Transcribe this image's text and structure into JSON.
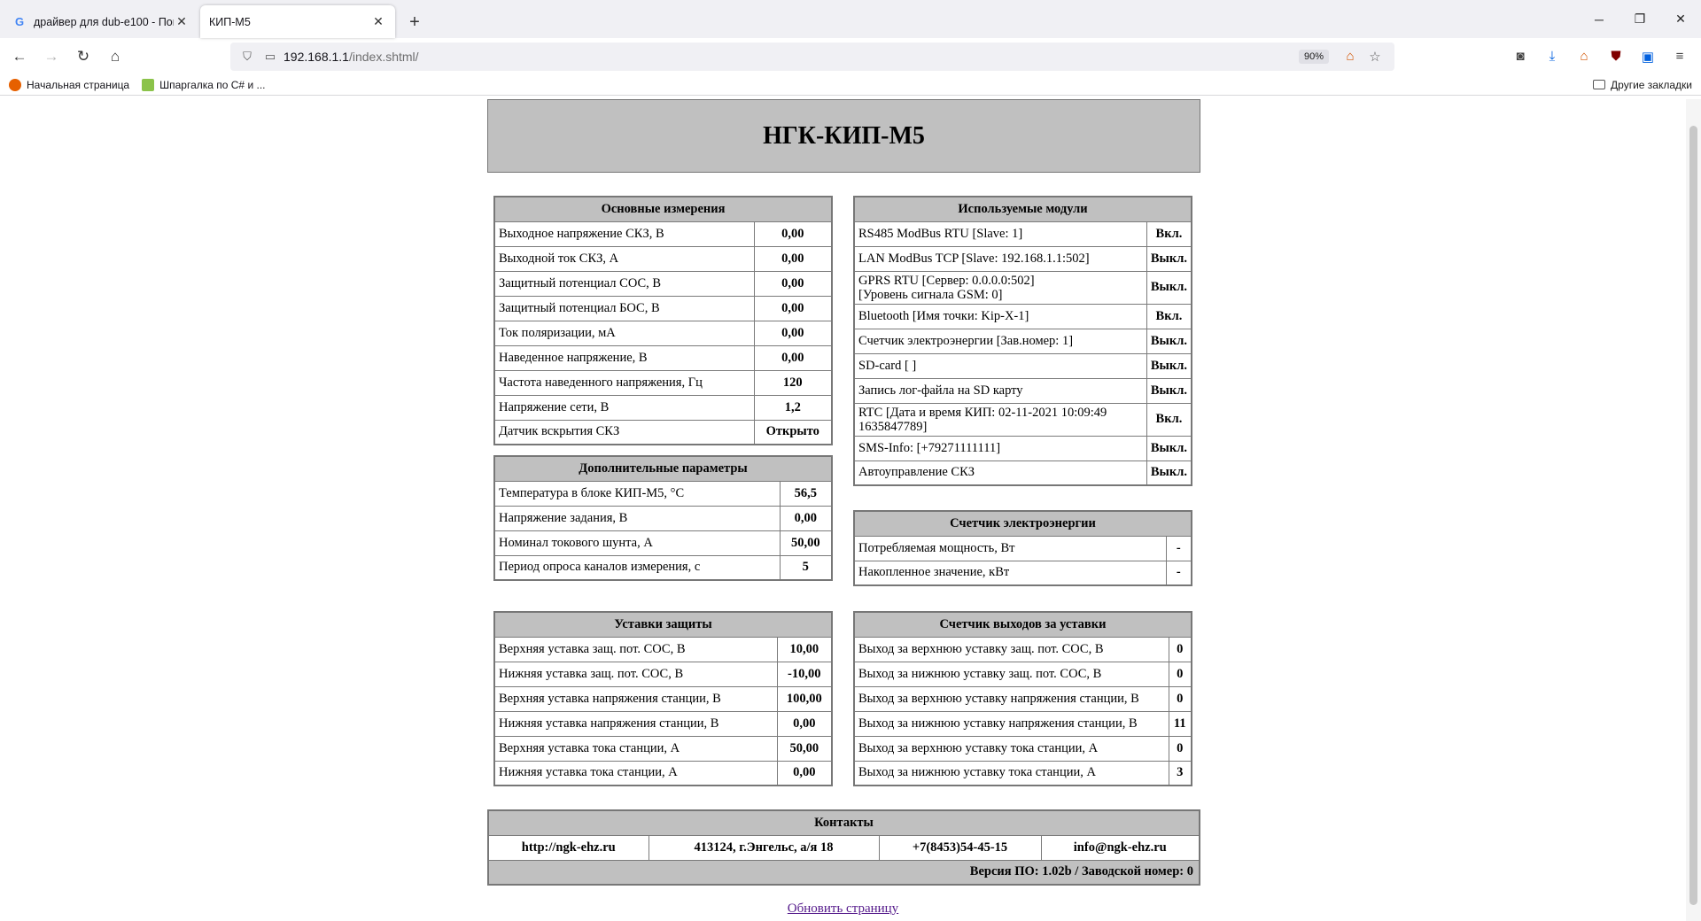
{
  "browser": {
    "tabs": [
      {
        "favicon": "G",
        "title": "драйвер для dub-e100 - Поиск"
      },
      {
        "favicon": "",
        "title": "КИП-М5"
      }
    ],
    "url_host": "192.168.1.1",
    "url_path": "/index.shtml/",
    "zoom": "90%",
    "bookmarks": [
      "Начальная страница",
      "Шпаргалка по C# и ..."
    ],
    "other_bookmarks": "Другие закладки"
  },
  "page": {
    "title": "НГК-КИП-М5",
    "main_measurements": {
      "header": "Основные измерения",
      "rows": [
        {
          "label": "Выходное напряжение СКЗ, В",
          "value": "0,00"
        },
        {
          "label": "Выходной ток СКЗ, А",
          "value": "0,00"
        },
        {
          "label": "Защитный потенциал СОС, В",
          "value": "0,00"
        },
        {
          "label": "Защитный потенциал БОС, В",
          "value": "0,00"
        },
        {
          "label": "Ток поляризации, мА",
          "value": "0,00"
        },
        {
          "label": "Наведенное напряжение, В",
          "value": "0,00"
        },
        {
          "label": "Частота наведенного напряжения, Гц",
          "value": "120"
        },
        {
          "label": "Напряжение сети, В",
          "value": "1,2"
        },
        {
          "label": "Датчик вскрытия СКЗ",
          "value": "Открыто"
        }
      ]
    },
    "modules": {
      "header": "Используемые модули",
      "rows": [
        {
          "label": "RS485 ModBus RTU [Slave: 1]",
          "value": "Вкл."
        },
        {
          "label": "LAN ModBus TCP [Slave: 192.168.1.1:502]",
          "value": "Выкл."
        },
        {
          "label": "GPRS RTU [Сервер: 0.0.0.0:502]",
          "label2": "[Уровень сигнала GSM: 0]",
          "value": "Выкл."
        },
        {
          "label": "Bluetooth [Имя точки: Kip-X-1]",
          "value": "Вкл."
        },
        {
          "label": "Счетчик электроэнергии [Зав.номер: 1]",
          "value": "Выкл."
        },
        {
          "label": "SD-card [ ]",
          "value": "Выкл."
        },
        {
          "label": "Запись лог-файла на SD карту",
          "value": "Выкл."
        },
        {
          "label": "RTC [Дата и время КИП: 02-11-2021 10:09:49",
          "label2": "1635847789]",
          "value": "Вкл."
        },
        {
          "label": "SMS-Info: [+79271111111]",
          "value": "Выкл."
        },
        {
          "label": "Автоуправление СКЗ",
          "value": "Выкл."
        }
      ]
    },
    "extra_params": {
      "header": "Дополнительные параметры",
      "rows": [
        {
          "label": "Температура в блоке КИП-М5, °C",
          "value": "56,5"
        },
        {
          "label": "Напряжение задания, В",
          "value": "0,00"
        },
        {
          "label": "Номинал токового шунта, А",
          "value": "50,00"
        },
        {
          "label": "Период опроса каналов измерения, с",
          "value": "5"
        }
      ]
    },
    "energy_meter": {
      "header": "Счетчик электроэнергии",
      "rows": [
        {
          "label": "Потребляемая мощность, Вт",
          "value": "-"
        },
        {
          "label": "Накопленное значение, кВт",
          "value": "-"
        }
      ]
    },
    "protection": {
      "header": "Уставки защиты",
      "rows": [
        {
          "label": "Верхняя уставка защ. пот. СОС, В",
          "value": "10,00"
        },
        {
          "label": "Нижняя уставка защ. пот. СОС, В",
          "value": "-10,00"
        },
        {
          "label": "Верхняя уставка напряжения станции, В",
          "value": "100,00"
        },
        {
          "label": "Нижняя уставка напряжения станции, В",
          "value": "0,00"
        },
        {
          "label": "Верхняя уставка тока станции, А",
          "value": "50,00"
        },
        {
          "label": "Нижняя уставка тока станции, А",
          "value": "0,00"
        }
      ]
    },
    "exits": {
      "header": "Счетчик выходов за уставки",
      "rows": [
        {
          "label": "Выход за верхнюю уставку защ. пот. СОС, В",
          "value": "0"
        },
        {
          "label": "Выход за нижнюю уставку защ. пот. СОС, В",
          "value": "0"
        },
        {
          "label": "Выход за верхнюю уставку напряжения станции, В",
          "value": "0"
        },
        {
          "label": "Выход за нижнюю уставку напряжения станции, В",
          "value": "11"
        },
        {
          "label": "Выход за верхнюю уставку тока станции, А",
          "value": "0"
        },
        {
          "label": "Выход за нижнюю уставку тока станции, А",
          "value": "3"
        }
      ]
    },
    "contacts": {
      "header": "Контакты",
      "site": "http://ngk-ehz.ru",
      "address": "413124, г.Энгельс, а/я 18",
      "phone": "+7(8453)54-45-15",
      "email": "info@ngk-ehz.ru",
      "version": "Версия ПО: 1.02b / Заводской номер: 0"
    },
    "refresh_link": "Обновить страницу"
  }
}
